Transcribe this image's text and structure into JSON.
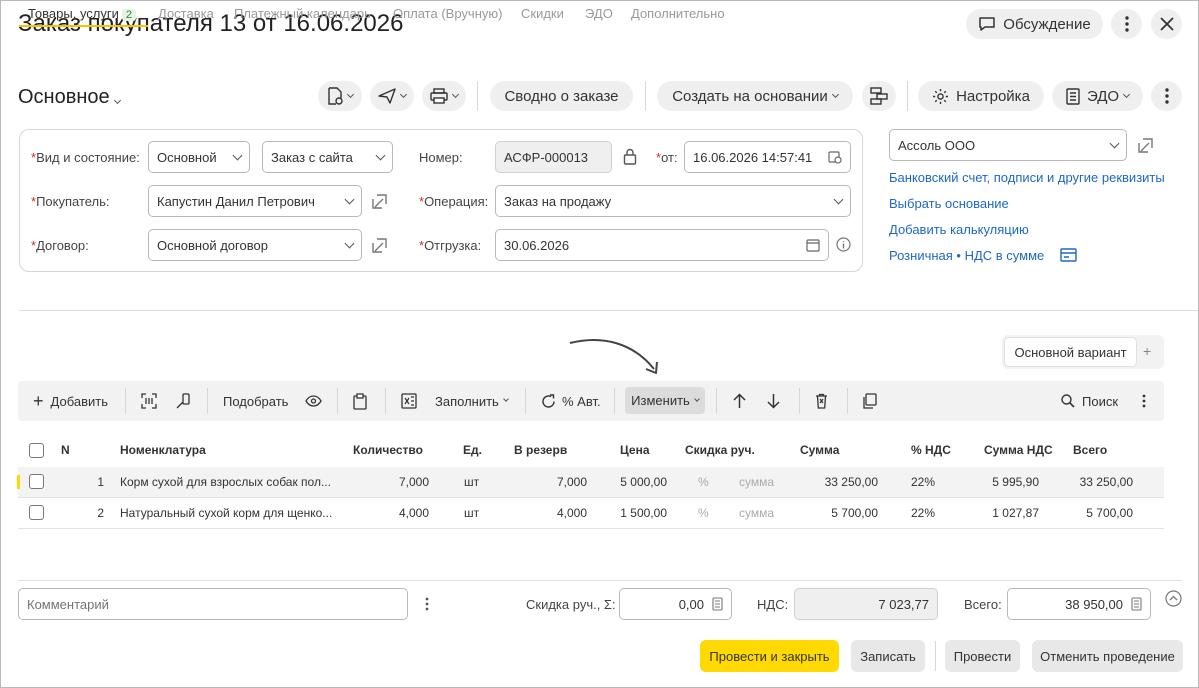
{
  "window": {
    "title": "Заказ покупателя 13 от 16.06.2026",
    "discuss_label": "Обсуждение"
  },
  "header": {
    "section_label": "Основное",
    "summary_label": "Сводно о заказе",
    "create_based_label": "Создать на основании",
    "settings_label": "Настройка",
    "edo_label": "ЭДО"
  },
  "form": {
    "kind_label": "Вид и состояние:",
    "kind_value": "Основной",
    "state_value": "Заказ с сайта",
    "number_label": "Номер:",
    "number_value": "АСФР-000013",
    "date_label": "от:",
    "date_value": "16.06.2026 14:57:41",
    "buyer_label": "Покупатель:",
    "buyer_value": "Капустин Данил Петрович",
    "operation_label": "Операция:",
    "operation_value": "Заказ на продажу",
    "contract_label": "Договор:",
    "contract_value": "Основной договор",
    "shipment_label": "Отгрузка:",
    "shipment_value": "30.06.2026",
    "required_mark": "*"
  },
  "side": {
    "org_value": "Ассоль ООО",
    "links": [
      "Банковский счет, подписи и другие реквизиты",
      "Выбрать основание",
      "Добавить калькуляцию",
      "Розничная • НДС в сумме"
    ]
  },
  "tabs": [
    {
      "label": "Товары, услуги",
      "badge": "2"
    },
    {
      "label": "Доставка"
    },
    {
      "label": "Платежный календарь"
    },
    {
      "label": "Оплата (Вручную)"
    },
    {
      "label": "Скидки"
    },
    {
      "label": "ЭДО"
    },
    {
      "label": "Дополнительно"
    }
  ],
  "variant": {
    "label": "Основной вариант",
    "add": "+"
  },
  "toolbar": {
    "add_label": "Добавить",
    "pick_label": "Подобрать",
    "fill_label": "Заполнить",
    "auto_label": "% Авт.",
    "change_label": "Изменить",
    "search_label": "Поиск"
  },
  "table": {
    "columns": [
      "N",
      "Номенклатура",
      "Количество",
      "Ед.",
      "В резерв",
      "Цена",
      "Скидка руч.",
      "Сумма",
      "% НДС",
      "Сумма НДС",
      "Всего"
    ],
    "rows": [
      {
        "n": "1",
        "name": "Корм сухой для взрослых собак пол...",
        "qty": "7,000",
        "unit": "шт",
        "reserve": "7,000",
        "price": "5 000,00",
        "disc_pct": "%",
        "disc_sum": "сумма",
        "sum": "33 250,00",
        "vat_rate": "22%",
        "vat_sum": "5 995,90",
        "total": "33 250,00"
      },
      {
        "n": "2",
        "name": "Натуральный сухой корм для щенко...",
        "qty": "4,000",
        "unit": "шт",
        "reserve": "4,000",
        "price": "1 500,00",
        "disc_pct": "%",
        "disc_sum": "сумма",
        "sum": "5 700,00",
        "vat_rate": "22%",
        "vat_sum": "1 027,87",
        "total": "5 700,00"
      }
    ]
  },
  "footer": {
    "comment_placeholder": "Комментарий",
    "discount_label": "Скидка руч., Σ:",
    "discount_value": "0,00",
    "vat_label": "НДС:",
    "vat_value": "7 023,77",
    "total_label": "Всего:",
    "total_value": "38 950,00"
  },
  "actions": {
    "post_close": "Провести и закрыть",
    "save": "Записать",
    "post": "Провести",
    "unpost": "Отменить проведение"
  },
  "colors": {
    "accent": "#ffd900",
    "link": "#1e68c4",
    "required": "#d02b2b"
  }
}
